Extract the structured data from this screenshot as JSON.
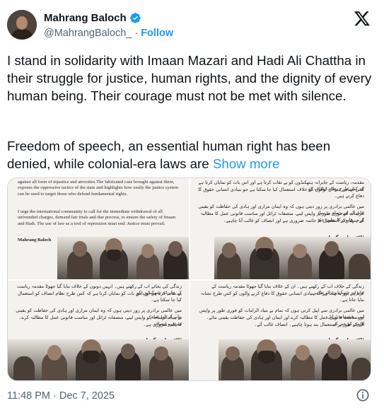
{
  "author": {
    "display_name": "Mahrang Baloch",
    "handle": "@MahrangBaloch_",
    "separator": "·",
    "follow_label": "Follow",
    "verified_icon": "verified-badge-icon",
    "accent_color": "#1d9bf0"
  },
  "platform_logo": "x-logo-icon",
  "tweet": {
    "paragraph_1": "I stand in solidarity with Imaan Mazari and Hadi Ali Chattha in their struggle for justice, human rights, and the dignity of every human being. Their courage must not be met with silence.",
    "paragraph_2": "Freedom of speech, an essential human right has been denied, while colonial-era laws are",
    "show_more": "Show more"
  },
  "media": {
    "image_1": {
      "text": "against all form of injustice and atrocities.The fabricated case brought against them, exposes the oppressive tactics of the state and highlights how easily the justice system can be used to target those who defend fundamental rights.",
      "text_2": "I urge the international community to call for the immediate withdrawal of all unfounded charges, demand fair trials and due process, to ensure the safety of Imaan and Hadi. The use of law as a tool of repression must end. Justice must prevail.",
      "signature": "Mahrang Baloch"
    },
    "image_2": {
      "line_1": "مقدمہ، ریاست کے جابرانہ ہتھکنڈوں کو بے نقاب کرتا ہے اور اس بات کو نمایاں کرتا ہے کہ کس طرح نظام انصاف کو",
      "line_2": "کتنی آسانی سے ان لوگوں کے خلاف استعمال کیا جا سکتا ہے جو بنیادی انسانی حقوق کا دفاع کرتے ہیں۔",
      "line_3": "میں عالمی برادری پر زور دیتی ہوں کہ وہ ایمان مزاری اور ہادی کی حفاظت کو یقینی بنانے کے لیے، تمام بے بنیاد",
      "line_4": "الزامات کو فوری طور پر واپس لینے، منصفانہ ٹرائل اور مناسب قانونی عمل کا مطالبہ کرے۔ قانون کا بطور جبر",
      "line_5": "کے ہتھیار کے استعمال کا خاتمہ ضروری ہے اور انصاف کو غالب آنا چاہیے۔",
      "signature": "ڈاکٹر ماہ رنگ بلوچ"
    },
    "image_3": {
      "line_1": "زندگی کی بجائے اب کے رکھتے ہیں۔ انہیں دونوں کے خلاف بنایا گیا جھوٹا مقدمہ ریاست کے جابرانہ ہتھکنڈوں کو",
      "line_2": "بے نقاب کرتا ہے اور اس بات کو نمایاں کرتا ہے کہ کس طرح نظام انصاف کو استعمال کیا جا سکتا ہے۔",
      "line_3": "میں عالمی برادری پر زور دیتی ہوں کہ وہ ایمان مزاری اور ہادی کی حفاظت کو یقینی بنانے کے لیے تمام",
      "line_4": "بے بنیاد الزامات کو واپس لینے، منصفانہ ٹرائل اور مناسب قانونی عمل کا مطالبہ کرے۔ سرخرو انصاف",
      "line_5": "کا غلبہ ضروری ہے۔",
      "signature": "ڈاکٹر ماہ رنگ بلوچ"
    },
    "image_4": {
      "line_1": "زندگی کے خلاف اب کے رکھتے ہیں۔ ان کے خلاف بنایا گیا جھوٹا مقدمہ ریاست کے جابرانہ ہتھکنڈوں کو ظاہر",
      "line_2": "کرتا ہے اور یہ بتاتا ہے کہ بنیادی انسانی حقوق کا دفاع کرنے والوں کو کس طرح نشانہ بنایا جاتا ہے۔",
      "line_3": "میں عالمی برادری سے اپیل کرتی ہوں کہ تمام بے بنیاد الزامات کو فوری طور پر واپس لینے، منصفانہ ٹرائل",
      "line_4": "اور مناسب قانونی عمل کا مطالبہ کرے اور ایمان اور ہادی کی حفاظت یقینی بنائے۔ قانون کو جبر کے",
      "line_5": "آلے کے طور پر استعمال بند ہونا چاہیے۔ انصاف غالب آئے۔",
      "signature": "ڈاکٹر ماہ رنگ بلوچ"
    }
  },
  "footer": {
    "time": "11:48 PM",
    "separator": "·",
    "date": "Dec 7, 2025",
    "info_icon": "info-icon"
  }
}
